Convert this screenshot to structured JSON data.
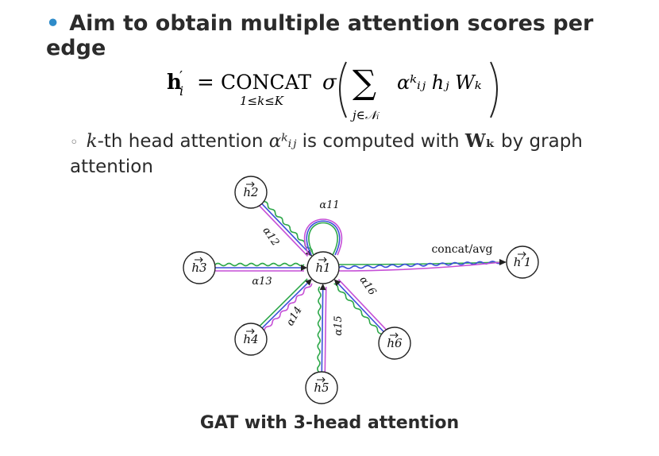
{
  "heading": {
    "bullet": "•",
    "text": "Aim to obtain multiple attention scores per edge"
  },
  "formula": {
    "lhs": "h′ᵢ",
    "equals": "=",
    "operator": "CONCAT",
    "operator_sub": "1≤k≤K",
    "sigma": "σ",
    "sum_sub": "j∈𝒩ᵢ",
    "term": "αᵏᵢⱼ hⱼ Wₖ"
  },
  "sub_bullet": {
    "bullet": "◦",
    "k": "k",
    "part1": "-th head attention",
    "alpha": "αᵏᵢⱼ",
    "part2": "is computed with",
    "W": "Wₖ",
    "part3": "by graph attention"
  },
  "diagram": {
    "nodes": [
      {
        "id": "h1",
        "label": "h1"
      },
      {
        "id": "h2",
        "label": "h2"
      },
      {
        "id": "h3",
        "label": "h3"
      },
      {
        "id": "h4",
        "label": "h4"
      },
      {
        "id": "h5",
        "label": "h5"
      },
      {
        "id": "h6",
        "label": "h6"
      },
      {
        "id": "out",
        "label": "h′1"
      }
    ],
    "edge_labels": [
      "α11",
      "α12",
      "α13",
      "α14",
      "α15",
      "α16"
    ],
    "output_label": "concat/avg",
    "head_colors": [
      "#2ea84a",
      "#3b4fd9",
      "#c64fd6"
    ]
  },
  "caption": "GAT with 3-head attention"
}
